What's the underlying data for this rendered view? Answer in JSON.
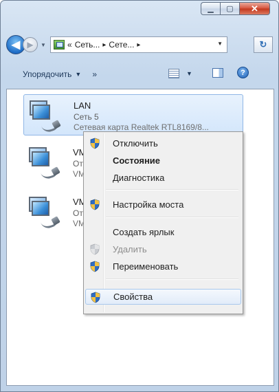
{
  "window": {
    "address": [
      "«",
      "Сеть...",
      "▸",
      "Сете...",
      "▸"
    ]
  },
  "toolbar": {
    "organize_label": "Упорядочить",
    "more_label": "»"
  },
  "connections": [
    {
      "name": "LAN",
      "network": "Сеть 5",
      "device": "Сетевая карта Realtek RTL8169/8...",
      "selected": true
    },
    {
      "name": "VM",
      "network": "От",
      "device": "VM",
      "selected": false
    },
    {
      "name": "VM",
      "network": "От",
      "device": "VM",
      "selected": false
    }
  ],
  "context_menu": {
    "items": [
      {
        "label": "Отключить",
        "shield": true,
        "bold": false,
        "disabled": false
      },
      {
        "label": "Состояние",
        "shield": false,
        "bold": true,
        "disabled": false
      },
      {
        "label": "Диагностика",
        "shield": false,
        "bold": false,
        "disabled": false
      },
      {
        "label": "Настройка моста",
        "shield": true,
        "bold": false,
        "disabled": false
      },
      {
        "label": "Создать ярлык",
        "shield": false,
        "bold": false,
        "disabled": false
      },
      {
        "label": "Удалить",
        "shield": true,
        "bold": false,
        "disabled": true
      },
      {
        "label": "Переименовать",
        "shield": true,
        "bold": false,
        "disabled": false
      },
      {
        "label": "Свойства",
        "shield": true,
        "bold": false,
        "disabled": false,
        "hovered": true
      }
    ]
  },
  "colors": {
    "selection": "#d3e6fb",
    "menu_bg": "#f0f0f0",
    "close_button": "#c2361c"
  }
}
